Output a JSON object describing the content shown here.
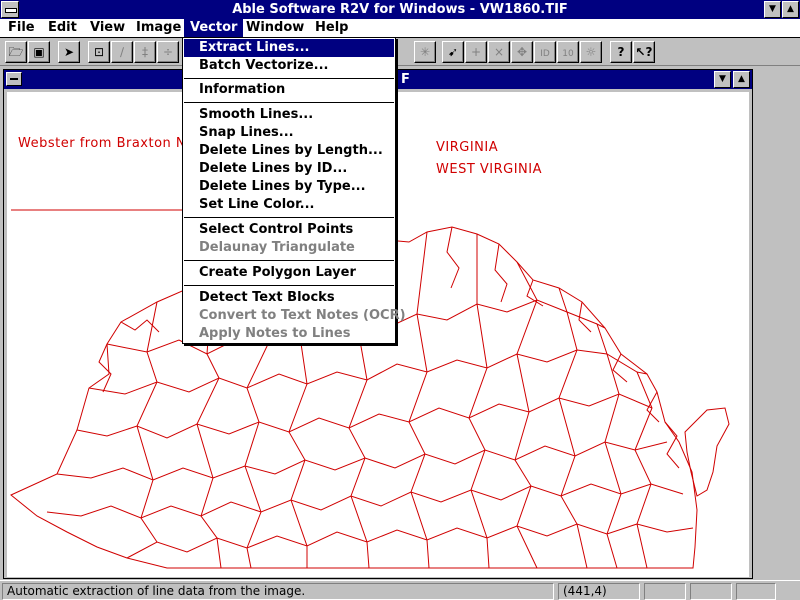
{
  "window": {
    "title": "Able Software R2V for Windows - VW1860.TIF"
  },
  "menubar": {
    "items": [
      "File",
      "Edit",
      "View",
      "Image",
      "Vector",
      "Window",
      "Help"
    ],
    "active": "Vector"
  },
  "document": {
    "title_suffix": "F"
  },
  "vector_menu": {
    "groups": [
      [
        "Extract Lines...",
        "Batch Vectorize..."
      ],
      [
        "Information"
      ],
      [
        "Smooth Lines...",
        "Snap Lines...",
        "Delete Lines by Length...",
        "Delete Lines by ID...",
        "Delete Lines by Type...",
        "Set Line Color..."
      ],
      [
        "Select Control Points",
        "Delaunay Triangulate"
      ],
      [
        "Create Polygon Layer"
      ],
      [
        "Detect Text Blocks",
        "Convert to Text Notes (OCR)",
        "Apply Notes to Lines"
      ]
    ],
    "selected": "Extract Lines...",
    "disabled": [
      "Delaunay Triangulate",
      "Convert to Text Notes (OCR)",
      "Apply Notes to Lines"
    ]
  },
  "map": {
    "label_left": "Webster from Braxton  Nic",
    "label_right_1": "VIRGINIA",
    "label_right_2": "WEST VIRGINIA",
    "line_color": "#d00000"
  },
  "statusbar": {
    "message": "Automatic extraction of line data  from the image.",
    "coords": "(441,4)"
  },
  "colors": {
    "titlebar": "#000080",
    "face": "#c0c0c0",
    "highlight": "#000080"
  }
}
